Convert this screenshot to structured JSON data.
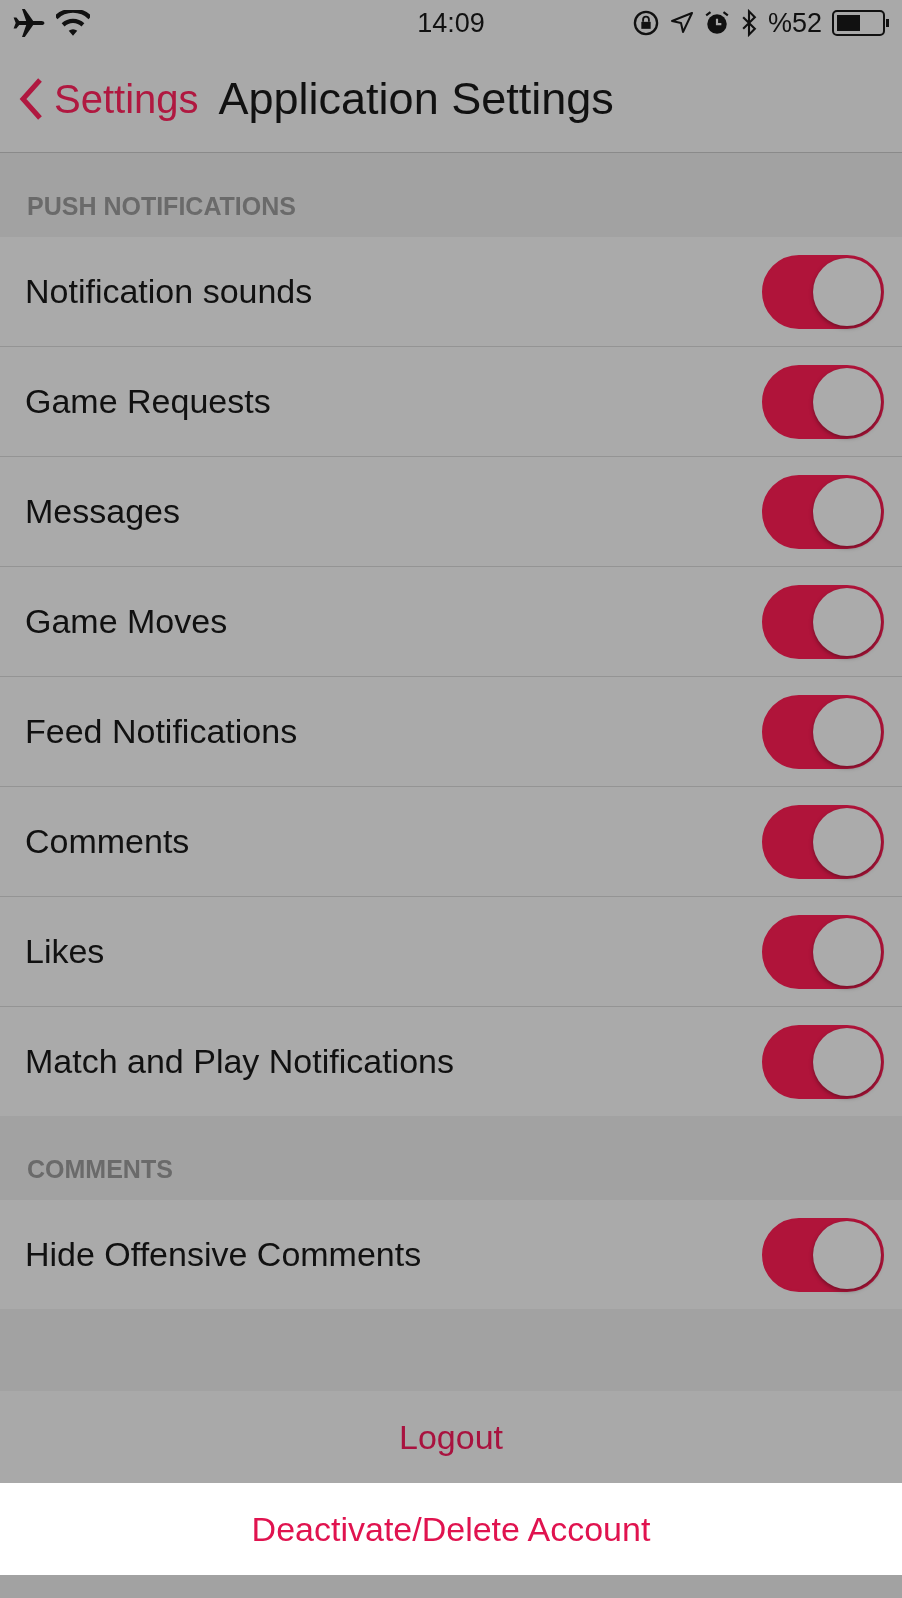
{
  "status_bar": {
    "time": "14:09",
    "battery": "%52"
  },
  "nav": {
    "back": "Settings",
    "title": "Application Settings"
  },
  "sections": [
    {
      "header": "PUSH NOTIFICATIONS",
      "rows": [
        {
          "label": "Notification sounds",
          "on": true
        },
        {
          "label": "Game Requests",
          "on": true
        },
        {
          "label": "Messages",
          "on": true
        },
        {
          "label": "Game Moves",
          "on": true
        },
        {
          "label": "Feed Notifications",
          "on": true
        },
        {
          "label": "Comments",
          "on": true
        },
        {
          "label": "Likes",
          "on": true
        },
        {
          "label": "Match and Play Notifications",
          "on": true
        }
      ]
    },
    {
      "header": "COMMENTS",
      "rows": [
        {
          "label": "Hide Offensive Comments",
          "on": true
        }
      ]
    }
  ],
  "actions": [
    {
      "label": "Logout",
      "highlighted": false
    },
    {
      "label": "Deactivate/Delete Account",
      "highlighted": true
    }
  ]
}
